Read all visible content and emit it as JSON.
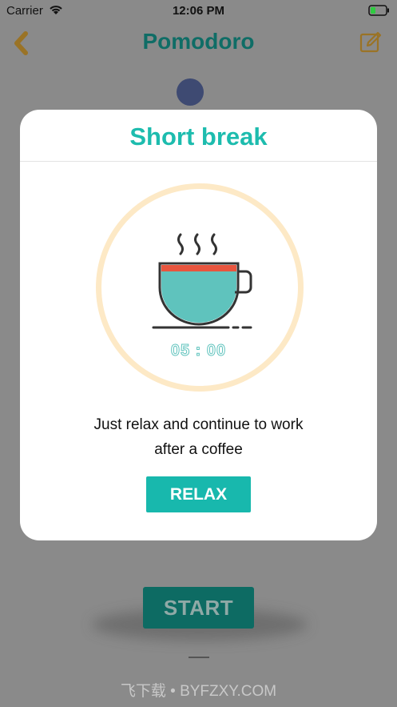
{
  "status_bar": {
    "carrier": "Carrier",
    "time": "12:06 PM"
  },
  "navbar": {
    "title": "Pomodoro",
    "back_icon": "chevron-left-icon",
    "edit_icon": "edit-icon"
  },
  "background": {
    "start_label": "START",
    "watermark": "飞下载 • BYFZXY.COM"
  },
  "modal": {
    "title": "Short break",
    "illustration": "coffee-cup-icon",
    "timer": "05 : 00",
    "message_line1": "Just relax and continue to work",
    "message_line2": "after a coffee",
    "button_label": "RELAX"
  },
  "colors": {
    "accent": "#1dbcae",
    "ring": "#fde9c6",
    "nav_icon": "#c8a15a",
    "overlay": "#8a8a8a",
    "cup_fill": "#5fc3bd",
    "cup_rim": "#e8553e"
  }
}
